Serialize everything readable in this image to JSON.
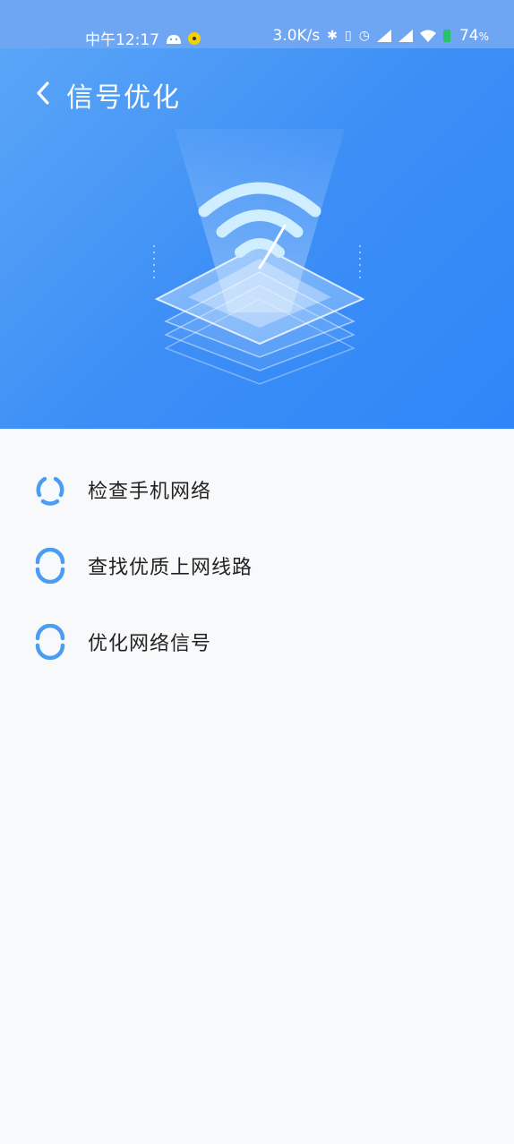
{
  "status_bar": {
    "time": "中午12:17",
    "speed": "3.0K/s",
    "battery": "74",
    "battery_unit": "%"
  },
  "header": {
    "title": "信号优化"
  },
  "tasks": [
    {
      "label": "检查手机网络"
    },
    {
      "label": "查找优质上网线路"
    },
    {
      "label": "优化网络信号"
    }
  ],
  "colors": {
    "accent": "#3d8ff6",
    "spinner": "#4a9df2",
    "background": "#f8f9fa"
  }
}
